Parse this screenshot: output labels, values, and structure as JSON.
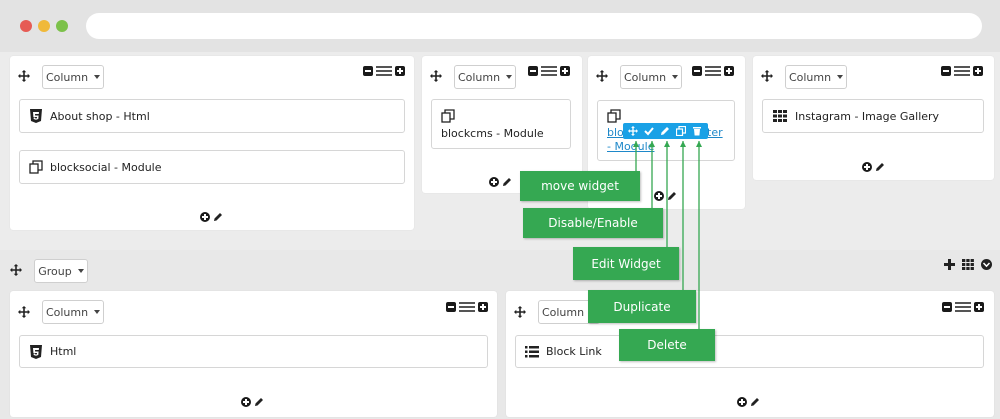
{
  "top_row": {
    "col1": {
      "dropdown": "Column",
      "widgets": [
        "About shop - Html",
        "blocksocial - Module"
      ]
    },
    "col2": {
      "dropdown": "Column",
      "widgets": [
        "blockcms - Module"
      ]
    },
    "col3": {
      "dropdown": "Column",
      "widget_line1": "blockne…ter",
      "widget_line1_start": "blo",
      "widget_line1_end": "ter",
      "widget_line2": "- Module"
    },
    "col4": {
      "dropdown": "Column",
      "widgets": [
        "Instagram - Image Gallery"
      ]
    }
  },
  "group_row": {
    "dropdown": "Group",
    "col1": {
      "dropdown": "Column",
      "widgets": [
        "Html"
      ]
    },
    "col2": {
      "dropdown": "Column",
      "widgets": [
        "Block Link"
      ]
    }
  },
  "callouts": {
    "move": "move widget",
    "disable": "Disable/Enable",
    "edit": "Edit Widget",
    "duplicate": "Duplicate",
    "delete": "Delete"
  },
  "colors": {
    "callout": "#35a852",
    "toolbar": "#1aa1e6",
    "link": "#1e88c9"
  }
}
